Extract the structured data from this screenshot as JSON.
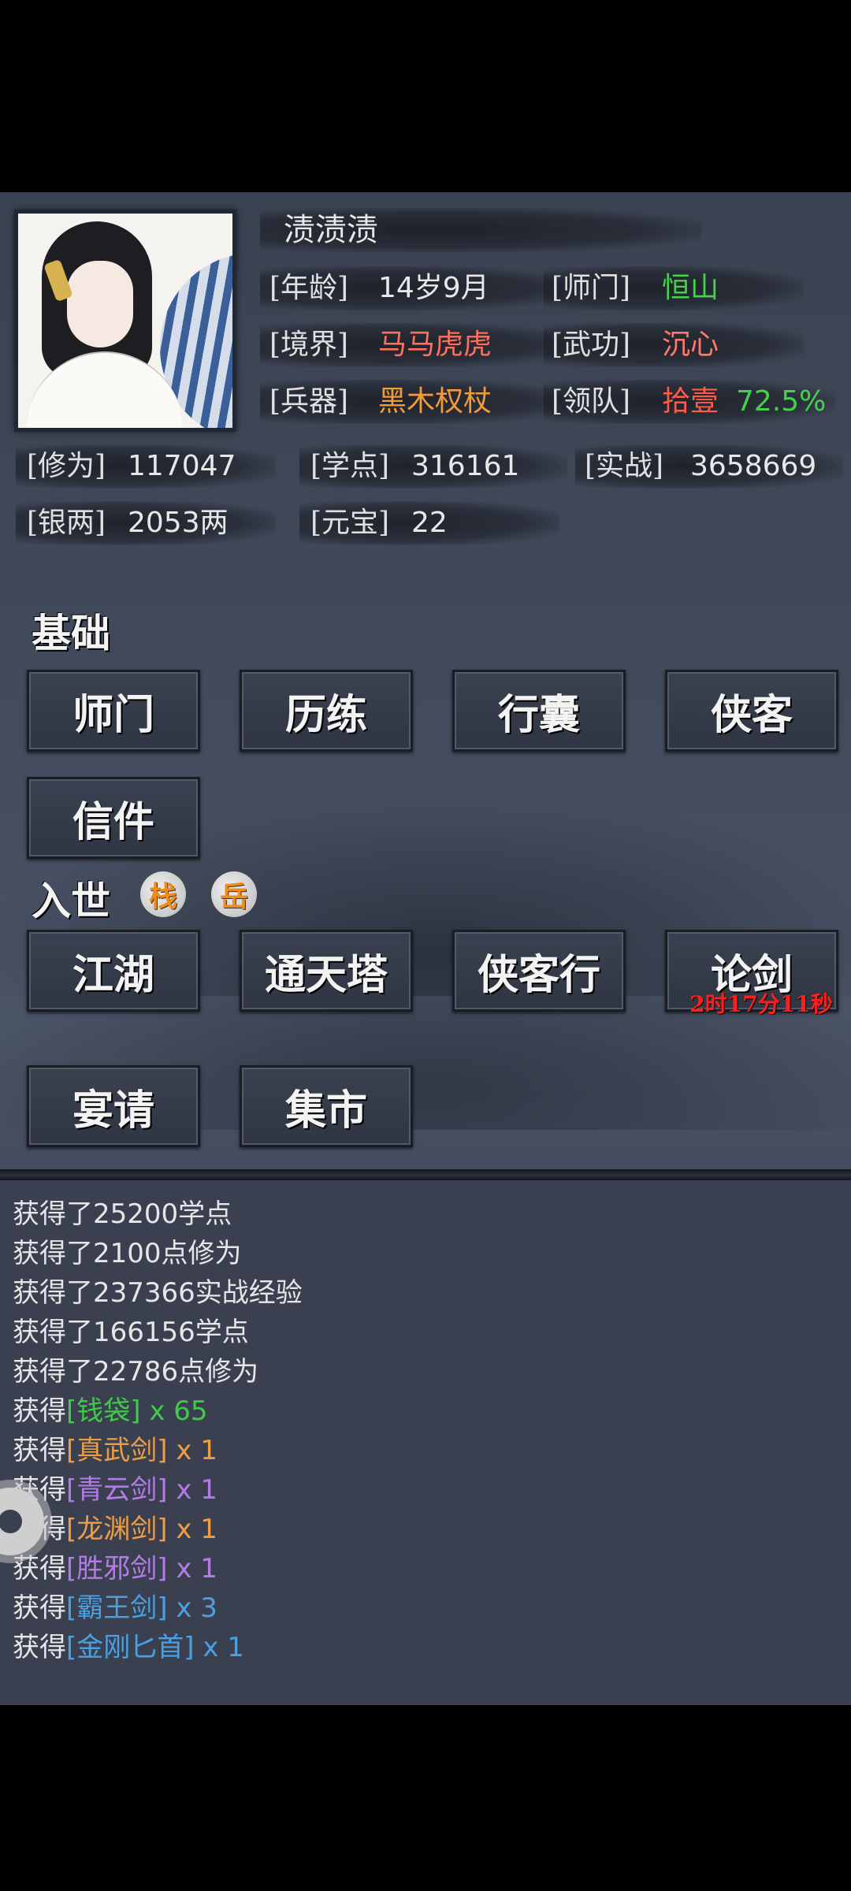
{
  "player": {
    "name": "渍渍渍",
    "stats": [
      {
        "label": "[年龄]",
        "value": "14岁9月",
        "color": "#e8e8e8"
      },
      {
        "label": "[师门]",
        "value": "恒山",
        "color": "#45d24a"
      },
      {
        "label": "[境界]",
        "value": "马马虎虎",
        "color": "#ff6f5e"
      },
      {
        "label": "[武功]",
        "value": "沉心",
        "color": "#ff7a68"
      },
      {
        "label": "[兵器]",
        "value": "黑木权杖",
        "color": "#f39a3a"
      },
      {
        "label": "[领队]",
        "value": "拾壹",
        "value2": "72.5%",
        "color": "#ff5a4a",
        "color2": "#45d24a"
      }
    ],
    "resources": [
      {
        "label": "[修为]",
        "value": "117047"
      },
      {
        "label": "[学点]",
        "value": "316161"
      },
      {
        "label": "[实战]",
        "value": "3658669"
      },
      {
        "label": "[银两]",
        "value": "2053两"
      },
      {
        "label": "[元宝]",
        "value": "22"
      }
    ]
  },
  "sections": {
    "basic": {
      "title": "基础",
      "buttons": [
        "师门",
        "历练",
        "行囊",
        "侠客",
        "信件"
      ]
    },
    "world": {
      "title": "入世",
      "badges": [
        "栈",
        "岳"
      ],
      "buttons": [
        "江湖",
        "通天塔",
        "侠客行",
        "论剑",
        "宴请",
        "集市"
      ],
      "timer": "2时17分11秒"
    }
  },
  "log": [
    {
      "prefix": "获得了25200学点"
    },
    {
      "prefix": "获得了2100点修为"
    },
    {
      "prefix": "获得了237366实战经验"
    },
    {
      "prefix": "获得了166156学点"
    },
    {
      "prefix": "获得了22786点修为"
    },
    {
      "prefix": "获得",
      "item": "[钱袋]",
      "count": " x 65",
      "color": "green"
    },
    {
      "prefix": "获得",
      "item": "[真武剑]",
      "count": " x 1",
      "color": "orange"
    },
    {
      "prefix": "获得",
      "item": "[青云剑]",
      "count": " x 1",
      "color": "purple"
    },
    {
      "prefix": "获得",
      "item": "[龙渊剑]",
      "count": " x 1",
      "color": "orange"
    },
    {
      "prefix": "获得",
      "item": "[胜邪剑]",
      "count": " x 1",
      "color": "purple"
    },
    {
      "prefix": "获得",
      "item": "[霸王剑]",
      "count": " x 3",
      "color": "blue"
    },
    {
      "prefix": "获得",
      "item": "[金刚匕首]",
      "count": " x 1",
      "color": "blue"
    }
  ],
  "icons": {
    "settings": "gear-icon"
  }
}
